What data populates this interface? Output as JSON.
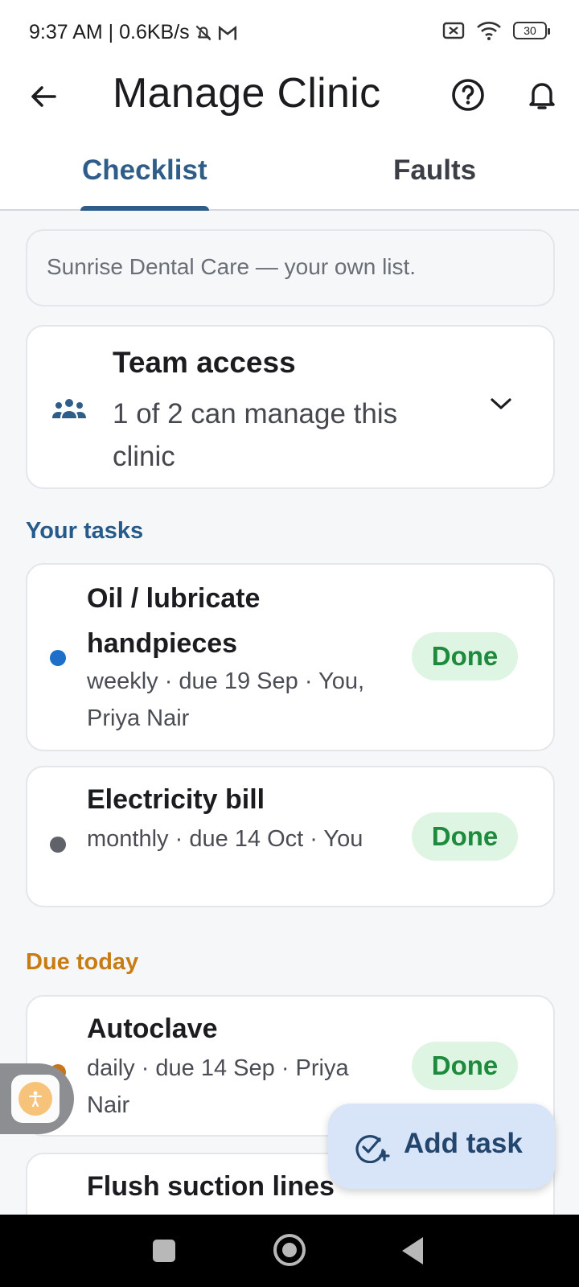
{
  "status_bar": {
    "time_speed": "9:37 AM | 0.6KB/s",
    "battery": "30"
  },
  "header": {
    "title": "Manage Clinic"
  },
  "tabs": [
    {
      "label": "Checklist",
      "active": true
    },
    {
      "label": "Faults",
      "active": false
    }
  ],
  "info_banner": "Sunrise Dental Care — your own list.",
  "team_access": {
    "title": "Team access",
    "subtitle": "1 of 2 can manage this clinic"
  },
  "sections": {
    "your_tasks": "Your tasks",
    "due_today": "Due today"
  },
  "tasks": [
    {
      "name": "Oil / lubricate handpieces",
      "meta": "weekly · due 19 Sep · You, Priya Nair",
      "action": "Done",
      "dot_color": "#1e6fc9"
    },
    {
      "name": "Electricity bill",
      "meta": "monthly · due 14 Oct · You",
      "action": "Done",
      "dot_color": "#5f6369"
    },
    {
      "name": "Autoclave",
      "meta": "daily · due 14 Sep · Priya Nair",
      "action": "Done",
      "dot_color": "#c8741a"
    },
    {
      "name": "Flush suction lines",
      "meta": "",
      "action": "",
      "dot_color": ""
    }
  ],
  "fab": {
    "label": "Add task"
  },
  "colors": {
    "accent": "#2f5d8a",
    "done_bg": "#dff5e3",
    "done_text": "#1e8a3c",
    "due_today": "#c87d14"
  }
}
